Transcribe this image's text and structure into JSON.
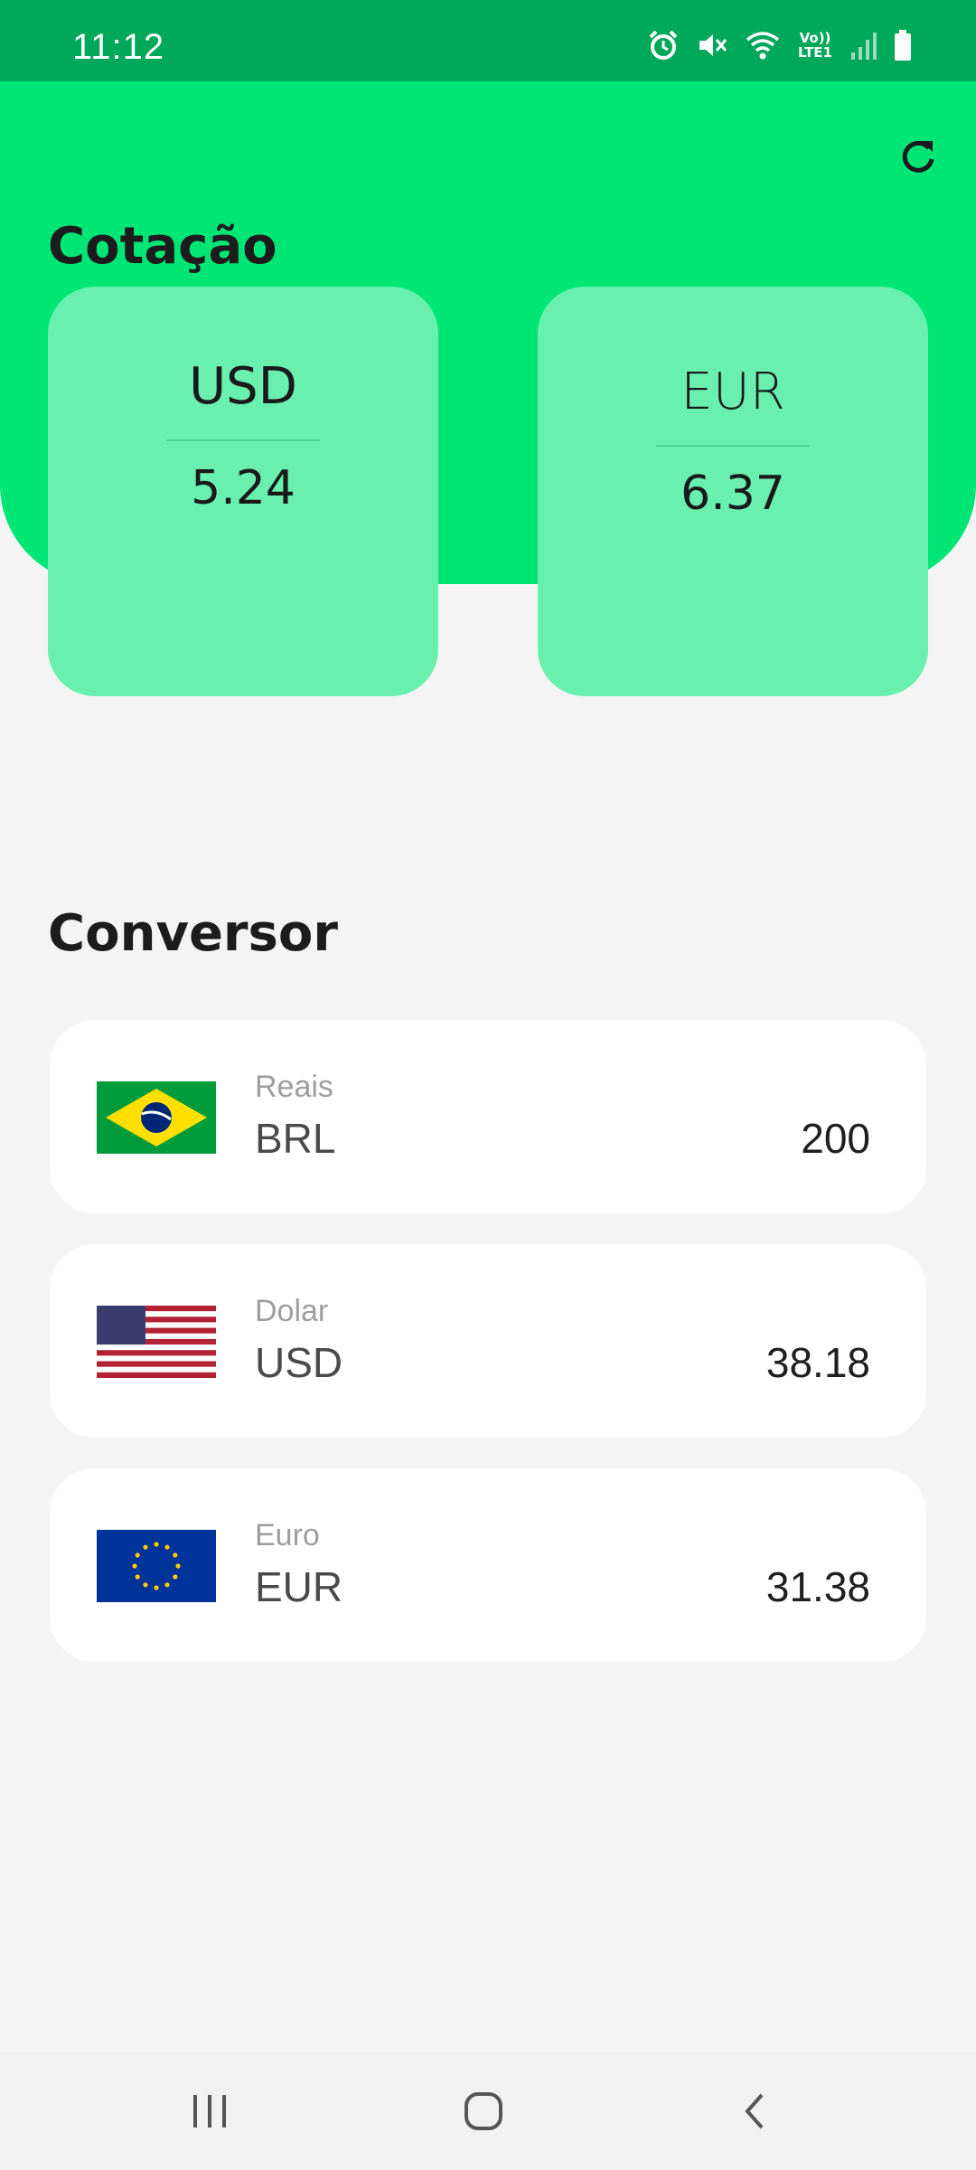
{
  "status_bar": {
    "time": "11:12",
    "network_label": "Vo)) LTE1",
    "icons": [
      "alarm-icon",
      "mute-icon",
      "wifi-icon",
      "lte-icon",
      "signal-icon",
      "battery-icon"
    ]
  },
  "header": {
    "refresh_icon": "refresh-icon",
    "background_color": "#00e676"
  },
  "cotacao": {
    "title": "Cotação",
    "cards": [
      {
        "code": "USD",
        "value": "5.24"
      },
      {
        "code": "EUR",
        "value": "6.37"
      }
    ]
  },
  "conversor": {
    "title": "Conversor",
    "rows": [
      {
        "name": "Reais",
        "code": "BRL",
        "value": "200",
        "flag": "brazil-flag"
      },
      {
        "name": "Dolar",
        "code": "USD",
        "value": "38.18",
        "flag": "usa-flag"
      },
      {
        "name": "Euro",
        "code": "EUR",
        "value": "31.38",
        "flag": "eu-flag"
      }
    ]
  },
  "nav_bar": {
    "buttons": [
      "recent-apps-icon",
      "home-icon",
      "back-icon"
    ]
  },
  "colors": {
    "status_bar": "#00a859",
    "accent": "#00e676",
    "card": "#69f0ae",
    "background": "#f4f4f4"
  }
}
